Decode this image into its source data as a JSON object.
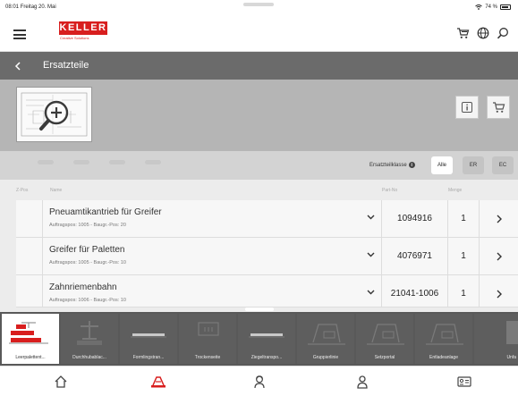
{
  "status": {
    "time": "08:01",
    "date": "Freitag 20. Mai",
    "battery": "74 %"
  },
  "brand": {
    "name": "KELLER",
    "tagline": "Creative Solutions"
  },
  "appbar": {
    "icons": [
      "menu-icon",
      "cart-icon",
      "globe-icon",
      "search-icon"
    ]
  },
  "page": {
    "title": "Ersatzteile"
  },
  "filter": {
    "label": "Ersatzteilklasse",
    "options": [
      "Alle",
      "ER",
      "EC"
    ],
    "selected": "Alle"
  },
  "columns": {
    "pos": "Z-Pos",
    "name": "Name",
    "partno": "Part-No",
    "qty": "Menge"
  },
  "rows": [
    {
      "name": "Pneuamtikantrieb für Greifer",
      "sub": "Auftragspos: 1005 - Baugr.-Pos: 20",
      "partno": "1094916",
      "qty": "1"
    },
    {
      "name": "Greifer für Paletten",
      "sub": "Auftragspos: 1005 - Baugr.-Pos: 10",
      "partno": "4076971",
      "qty": "1"
    },
    {
      "name": "Zahnriemenbahn",
      "sub": "Auftragspos: 1006 - Baugr.-Pos: 10",
      "partno": "21041-1006",
      "qty": "1"
    }
  ],
  "stations": [
    {
      "label": "Leerpalettent...",
      "active": true
    },
    {
      "label": "Durchhubablac..."
    },
    {
      "label": "Formlingstran..."
    },
    {
      "label": "Trockenseite"
    },
    {
      "label": "Ziegeltranspo..."
    },
    {
      "label": "Gruppierlinie"
    },
    {
      "label": "Setzportal"
    },
    {
      "label": "Entladeanlage"
    },
    {
      "label": "Unfa"
    }
  ],
  "tabs": [
    {
      "icon": "home-icon"
    },
    {
      "icon": "machine-icon",
      "active": true
    },
    {
      "icon": "service-person-icon"
    },
    {
      "icon": "user-icon"
    },
    {
      "icon": "id-card-icon"
    }
  ],
  "colors": {
    "brand_red": "#d81e1e",
    "titlebar": "#6b6b6b",
    "station_bar": "#595959",
    "active_tab": "#d81e1e"
  }
}
